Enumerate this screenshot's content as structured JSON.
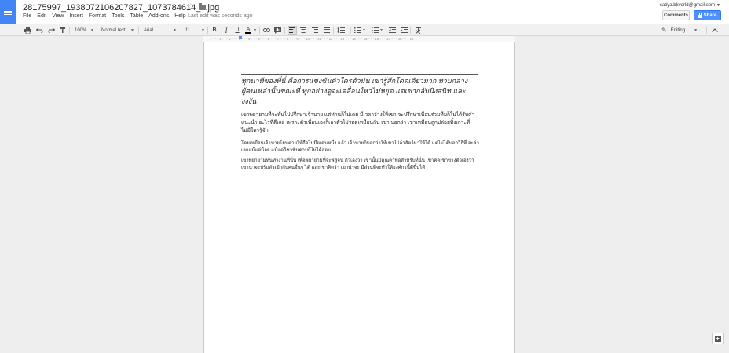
{
  "doc": {
    "title": "28175997_1938072106207827_1073784614_n.jpg",
    "last_edit": "Last edit was seconds ago"
  },
  "menu": [
    "File",
    "Edit",
    "View",
    "Insert",
    "Format",
    "Tools",
    "Table",
    "Add-ons",
    "Help"
  ],
  "account": {
    "email": "satiya.bkvorld@gmail.com"
  },
  "buttons": {
    "comments": "Comments",
    "share": "Share"
  },
  "toolbar": {
    "zoom": "100%",
    "style": "Normal text",
    "font": "Arial",
    "size": "11",
    "bold": "B",
    "italic": "I",
    "underline": "U",
    "text_color": "A",
    "mode": "Editing"
  },
  "ruler": {
    "labels": "1 · · · 1 · · · 2 · · · 3 · · · 4 · · · 5 · · · 6 · · · 7 · · · 8 · · · 9 · · · 10 · · · 11 · · · 12 · · · 13 · · · 14 · · · 15 · · · 16 · · · 17 · · · 18 · · · 19"
  },
  "content": {
    "p1": "ทุกนาทีของที่นี่ คือการแข่งขันตัวใครตัวมัน เขารู้สึกโดดเดี่ยวมาก ท่ามกลางผู้คนเหล่านั้นขณะที่ ทุกอย่างดูจะเคลื่อนไหวไม่หยุด แต่เขากลับนิ่งสนิท และงงงัน",
    "p2": "เขาพยายามที่จะหันไปปรึกษาเจ้านาย แต่ท่านก็ไม่เคย มีเวลาว่างให้เขา จะปรึกษาเพื่อนร่วมทีมก็ไม่ได้รับคำแนะนำ อะไรที่ดีเลย เพราะตัวเพื่อนเองก็เอาตัวไม่รอดเหมือนกัน เขา บอกว่า เขาเหมือนถูกปล่อยทิ้งเกาะที่ไม่มีใครรู้จัก",
    "p3": "โดยเหมือนเจ้านายโยนคายให้ถือไปมือเดนหนึ่ง แล้ว เจ้านายก็บอกว่าให้เขาไปล่าสัตว์มาให้ได้ แต่ไม่ได้บอกวิธีที่ จะล่าเลยแม้แต่น้อย แม้แต่วิชาฟันดาบก็ไม่ได้สอน",
    "p4": "เขาพยายามทนทำงานที่นั่น เพื่อพยายามที่จะพิสูจน์ ตัวเองว่า เขานั้นมีคุณค่าพอสำหรับที่นั่น เขาคิดเข้าข้างตัวเองว่า เขาน่าจะปรับตัวเข้ากับคนอื่นๆ ได้ และเขาคิดว่า เขาน่าจะ มีส่วนที่จะทำให้องค์กรนี้ดีขึ้นได้"
  }
}
